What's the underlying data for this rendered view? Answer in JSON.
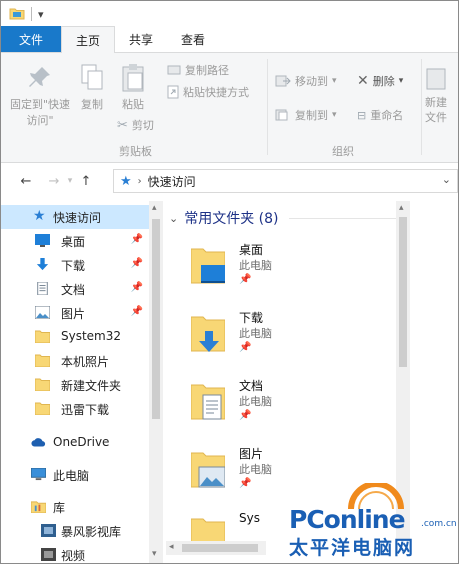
{
  "title_bar": {
    "qat_dropdown": "▾"
  },
  "ribbon_tabs": [
    "文件",
    "主页",
    "共享",
    "查看"
  ],
  "ribbon": {
    "clipboard": {
      "pin": "固定到\"快速访问\"",
      "copy": "复制",
      "paste": "粘贴",
      "copy_path": "复制路径",
      "paste_shortcut": "粘贴快捷方式",
      "cut": "剪切",
      "group_label": "剪贴板"
    },
    "organize": {
      "move_to": "移动到",
      "copy_to": "复制到",
      "delete": "删除",
      "rename": "重命名",
      "group_label": "组织"
    },
    "new": {
      "new_folder_line1": "新建",
      "new_folder_line2": "文件"
    }
  },
  "address": {
    "back": "←",
    "forward": "→",
    "up": "↑",
    "path": "快速访问",
    "dropdown": "⌄"
  },
  "nav_pane": {
    "items": [
      {
        "label": "快速访问",
        "icon": "star-icon",
        "pinned": false
      },
      {
        "label": "桌面",
        "icon": "desktop-icon",
        "pinned": true
      },
      {
        "label": "下载",
        "icon": "download-icon",
        "pinned": true
      },
      {
        "label": "文档",
        "icon": "document-icon",
        "pinned": true
      },
      {
        "label": "图片",
        "icon": "picture-icon",
        "pinned": true
      },
      {
        "label": "System32",
        "icon": "folder-icon",
        "pinned": false
      },
      {
        "label": "本机照片",
        "icon": "folder-icon",
        "pinned": false
      },
      {
        "label": "新建文件夹",
        "icon": "folder-icon",
        "pinned": false
      },
      {
        "label": "迅雷下载",
        "icon": "folder-icon",
        "pinned": false
      },
      {
        "label": "OneDrive",
        "icon": "cloud-icon",
        "pinned": false
      },
      {
        "label": "此电脑",
        "icon": "computer-icon",
        "pinned": false
      },
      {
        "label": "库",
        "icon": "library-icon",
        "pinned": false
      },
      {
        "label": "暴风影视库",
        "icon": "library-item-icon",
        "pinned": false
      },
      {
        "label": "视频",
        "icon": "video-icon",
        "pinned": false
      }
    ]
  },
  "main": {
    "group_header": "常用文件夹 (8)",
    "folders": [
      {
        "name": "桌面",
        "location": "此电脑",
        "overlay": "desktop"
      },
      {
        "name": "下载",
        "location": "此电脑",
        "overlay": "download"
      },
      {
        "name": "文档",
        "location": "此电脑",
        "overlay": "document"
      },
      {
        "name": "图片",
        "location": "此电脑",
        "overlay": "picture"
      },
      {
        "name": "Sys",
        "location": "",
        "overlay": "none"
      }
    ]
  },
  "watermark": {
    "brand": "PConline",
    "suffix": ".com.cn",
    "chinese": "太平洋电脑网"
  },
  "colors": {
    "accent": "#1979ca",
    "selection": "#cce8ff",
    "folder": "#f8d775",
    "folder_dark": "#e0b650",
    "watermark_blue": "#1a5fb4",
    "watermark_orange": "#f08a1c"
  }
}
